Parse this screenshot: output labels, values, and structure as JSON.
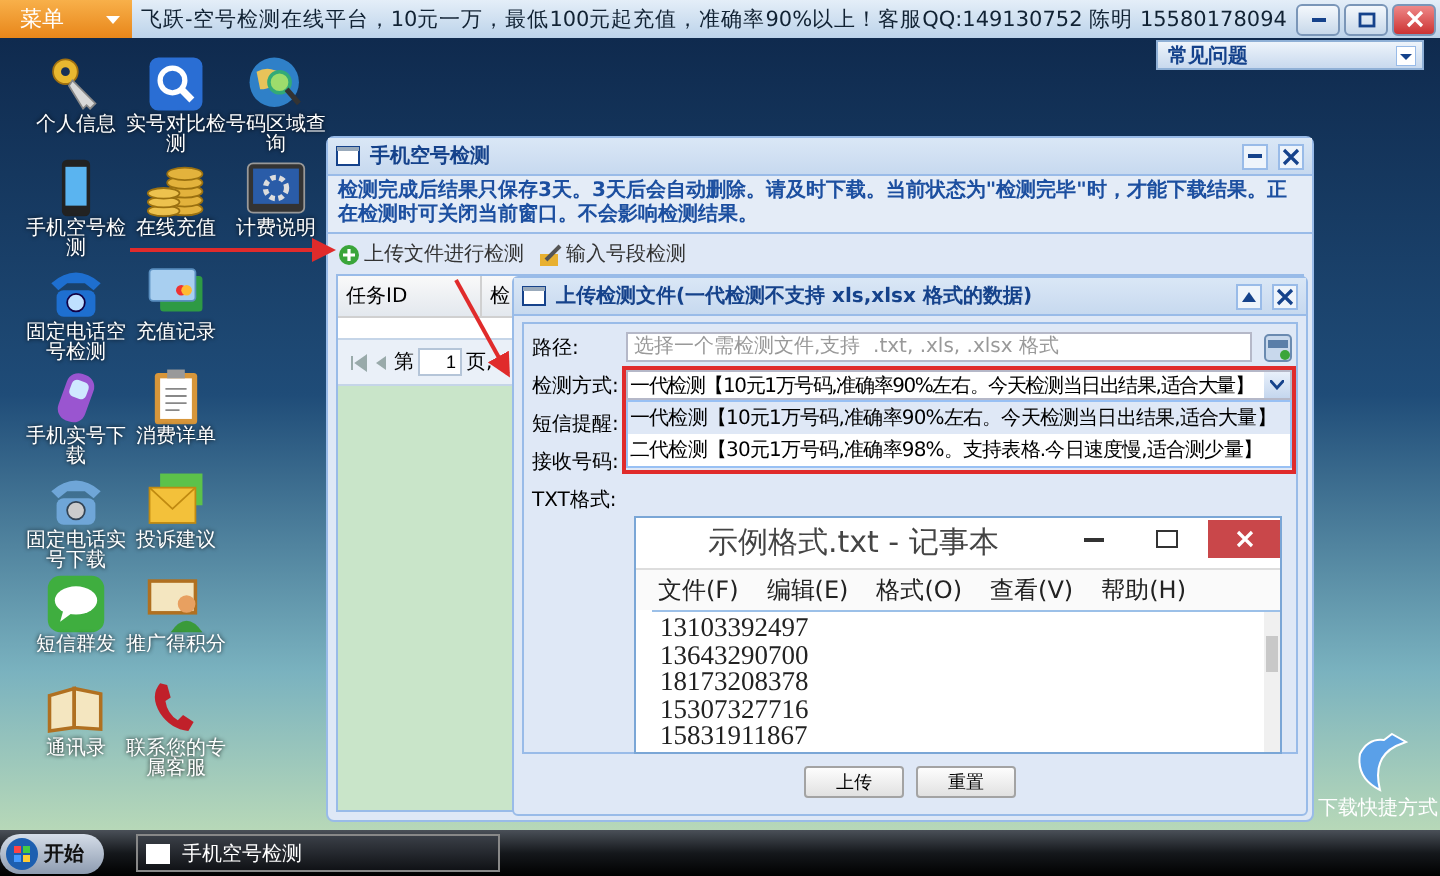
{
  "top_bar": {
    "menu_button": "菜单",
    "title": "飞跃-空号检测在线平台，10元一万，最低100元起充值，准确率90%以上！客服QQ:149130752   陈明 15580178094"
  },
  "side_panel": {
    "title": "常见问题"
  },
  "desktop_icons": [
    {
      "label": "个人信息",
      "kind": "key"
    },
    {
      "label": "实号对比检测",
      "kind": "search"
    },
    {
      "label": "号码区域查询",
      "kind": "globe"
    },
    {
      "label": "手机空号检测",
      "kind": "phone"
    },
    {
      "label": "在线充值",
      "kind": "coins"
    },
    {
      "label": "计费说明",
      "kind": "gear"
    },
    {
      "label": "固定电话空号检测",
      "kind": "telephone"
    },
    {
      "label": "充值记录",
      "kind": "card"
    },
    {
      "label": "手机实号下载",
      "kind": "mobile"
    },
    {
      "label": "消费详单",
      "kind": "clipboard"
    },
    {
      "label": "固定电话实号下载",
      "kind": "telephone-gray"
    },
    {
      "label": "投诉建议",
      "kind": "envelope"
    },
    {
      "label": "短信群发",
      "kind": "sms"
    },
    {
      "label": "推广得积分",
      "kind": "book-person"
    },
    {
      "label": "通讯录",
      "kind": "book"
    },
    {
      "label": "联系您的专属客服",
      "kind": "handset"
    }
  ],
  "main_window": {
    "title": "手机空号检测",
    "notice": "检测完成后结果只保存3天。3天后会自动删除。请及时下载。当前状态为\"检测完毕\"时，才能下载结果。正在检测时可关闭当前窗口。不会影响检测结果。",
    "toolbar": [
      {
        "label": "上传文件进行检测",
        "kind": "add"
      },
      {
        "label": "输入号段检测",
        "kind": "pencil"
      }
    ],
    "table": {
      "columns": [
        "任务ID",
        "检"
      ]
    },
    "pager": {
      "prefix": "第",
      "page": "1",
      "suffix": "页,"
    }
  },
  "upload_dialog": {
    "title": "上传检测文件(一代检测不支持  xls,xlsx 格式的数据)",
    "fields": [
      {
        "label": "路径:",
        "kind": "file",
        "placeholder": "选择一个需检测文件,支持  .txt, .xls, .xlsx 格式"
      },
      {
        "label": "检测方式:",
        "kind": "select",
        "value": "一代检测【10元1万号码,准确率90%左右。今天检测当日出结果,适合大量】"
      },
      {
        "label": "短信提醒:",
        "kind": "covered"
      },
      {
        "label": "接收号码:",
        "kind": "covered"
      },
      {
        "label": "TXT格式:",
        "kind": "covered"
      }
    ],
    "options": [
      {
        "label": "一代检测【10元1万号码,准确率90%左右。今天检测当日出结果,适合大量】",
        "selected": true
      },
      {
        "label": "二代检测【30元1万号码,准确率98%。支持表格.今日速度慢,适合测少量】",
        "selected": false
      }
    ],
    "buttons": [
      "上传",
      "重置"
    ]
  },
  "notepad": {
    "title": "示例格式.txt - 记事本",
    "menu": [
      "文件(F)",
      "编辑(E)",
      "格式(O)",
      "查看(V)",
      "帮助(H)"
    ],
    "lines": [
      "13103392497",
      "13643290700",
      "18173208378",
      "15307327716",
      "15831911867"
    ]
  },
  "shortcut": {
    "label": "下载快捷方式"
  },
  "taskbar": {
    "start": "开始",
    "tasks": [
      {
        "label": "手机空号检测",
        "selected": true
      }
    ]
  }
}
